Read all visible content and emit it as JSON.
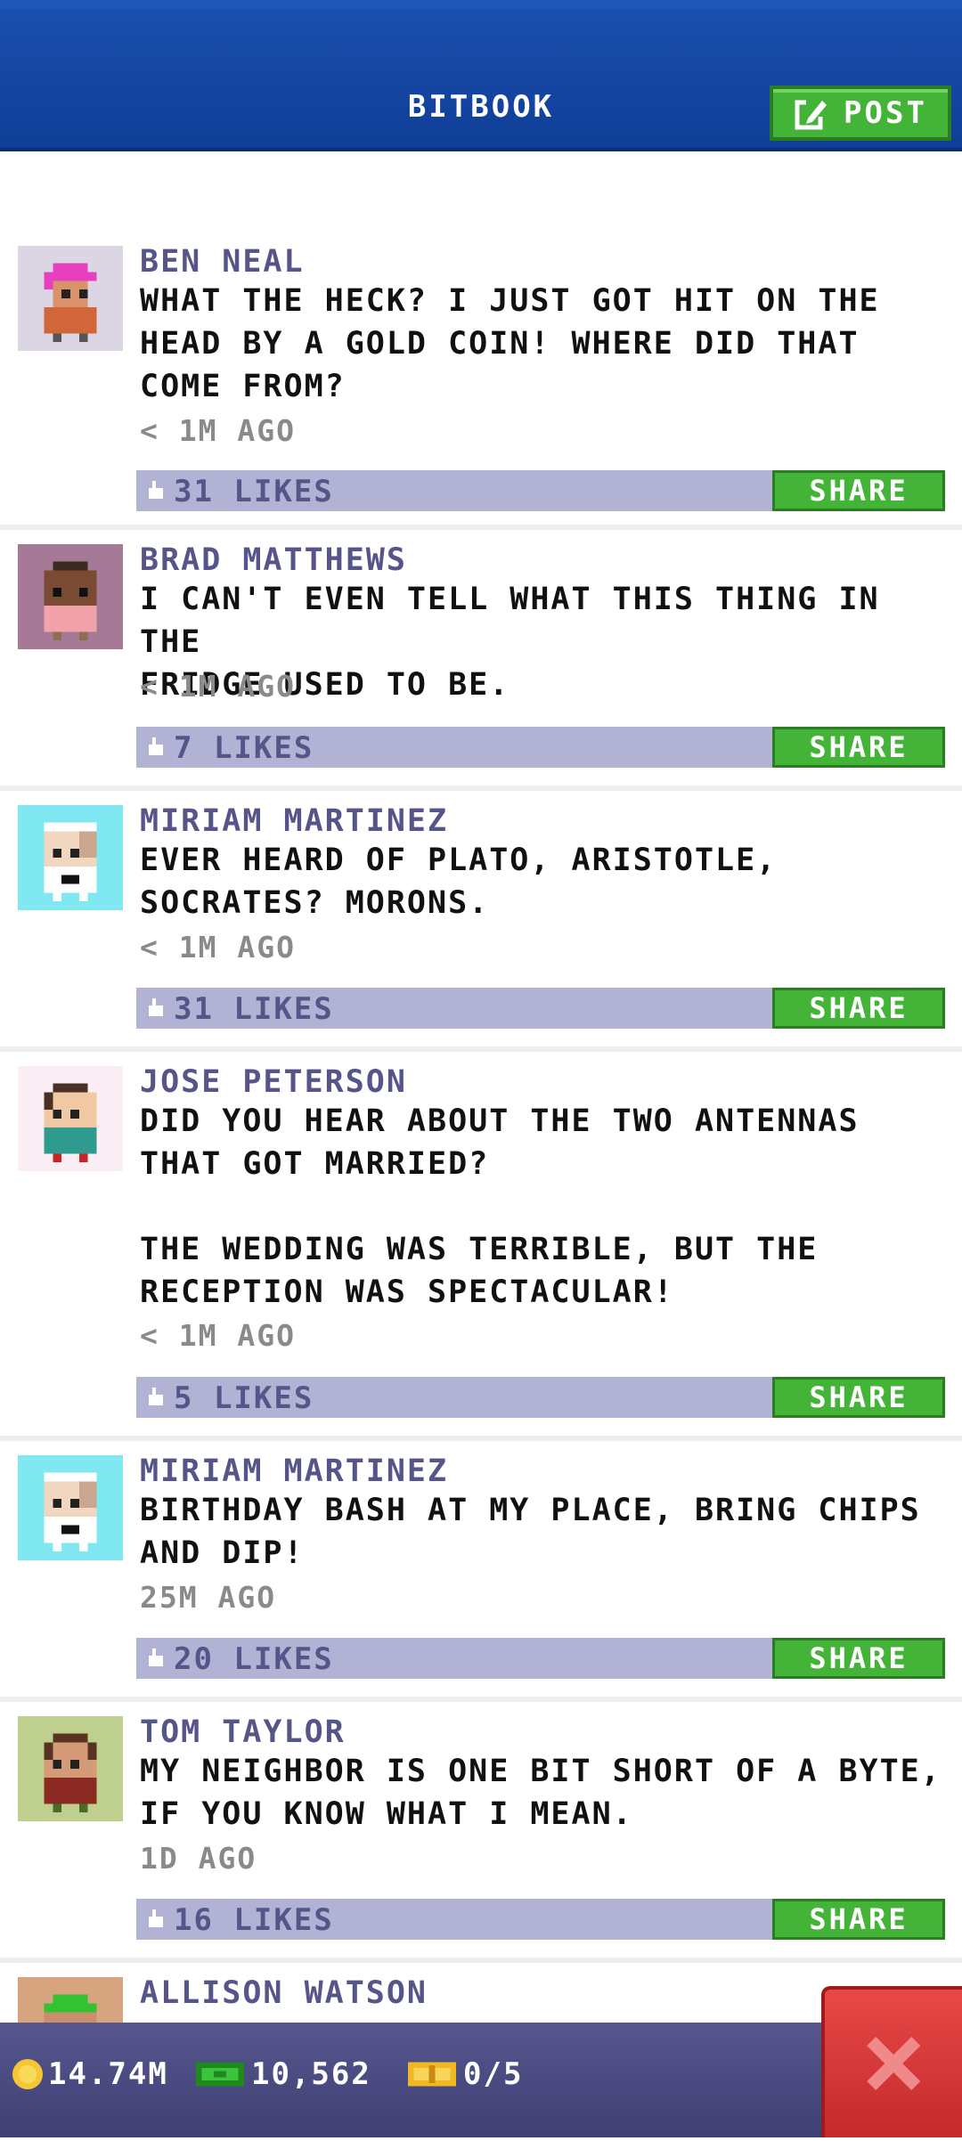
{
  "header": {
    "title": "BITBOOK",
    "post_label": "POST"
  },
  "posts": [
    {
      "author": "BEN NEAL",
      "text": "WHAT THE HECK? I JUST GOT HIT ON THE\nHEAD BY A GOLD COIN! WHERE DID THAT\nCOME FROM?",
      "time": "< 1M AGO",
      "likes": "31 LIKES",
      "share": "SHARE",
      "avatar": "pink-hair-citizen"
    },
    {
      "author": "BRAD MATTHEWS",
      "text": "I CAN'T EVEN TELL WHAT THIS THING IN THE\nFRIDGE USED TO BE.",
      "time": "< 1M AGO",
      "likes": "7 LIKES",
      "share": "SHARE",
      "avatar": "dark-skin-citizen"
    },
    {
      "author": "MIRIAM MARTINEZ",
      "text": "EVER HEARD OF PLATO, ARISTOTLE,\nSOCRATES? MORONS.",
      "time": "< 1M AGO",
      "likes": "31 LIKES",
      "share": "SHARE",
      "avatar": "karate-citizen"
    },
    {
      "author": "JOSE PETERSON",
      "text": "DID YOU HEAR ABOUT THE TWO ANTENNAS\nTHAT GOT MARRIED?\n\nTHE WEDDING WAS TERRIBLE, BUT THE\nRECEPTION WAS SPECTACULAR!",
      "time": "< 1M AGO",
      "likes": "5 LIKES",
      "share": "SHARE",
      "avatar": "teal-shirt-citizen"
    },
    {
      "author": "MIRIAM MARTINEZ",
      "text": "BIRTHDAY BASH AT MY PLACE, BRING CHIPS\nAND DIP!",
      "time": "25M AGO",
      "likes": "20 LIKES",
      "share": "SHARE",
      "avatar": "karate-citizen"
    },
    {
      "author": "TOM TAYLOR",
      "text": "MY NEIGHBOR IS ONE BIT SHORT OF A BYTE,\nIF YOU KNOW WHAT I MEAN.",
      "time": "1D AGO",
      "likes": "16 LIKES",
      "share": "SHARE",
      "avatar": "brown-shirt-citizen"
    },
    {
      "author": "ALLISON WATSON",
      "avatar": "green-hair-citizen"
    }
  ],
  "footer": {
    "coins": "14.74M",
    "bux": "10,562",
    "tickets": "0/5"
  },
  "colors": {
    "header_blue": "#0f3e97",
    "accent_green": "#43b437",
    "like_bar": "#b1b2d4",
    "name_purple": "#55558a",
    "close_red": "#d63434"
  }
}
